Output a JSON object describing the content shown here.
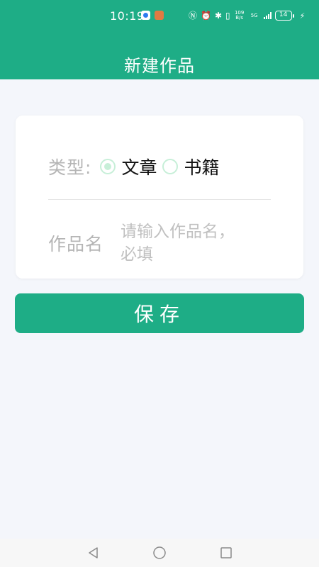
{
  "status_bar": {
    "time": "10:19",
    "net_speed_value": "109",
    "net_speed_unit": "B/s",
    "network": "5G",
    "battery_level": "14"
  },
  "header": {
    "title": "新建作品"
  },
  "form": {
    "type_label": "类型:",
    "type_options": [
      {
        "label": "文章",
        "selected": true
      },
      {
        "label": "书籍",
        "selected": false
      }
    ],
    "name_label": "作品名",
    "name_placeholder": "请输入作品名，必填",
    "name_value": ""
  },
  "actions": {
    "save_label": "保存"
  },
  "colors": {
    "primary": "#1ead86",
    "background": "#f4f6fb",
    "radio_tint": "#c7efd8",
    "label_gray": "#b5b5b5"
  },
  "icons": {
    "nav_back": "triangle-back-icon",
    "nav_home": "circle-home-icon",
    "nav_recent": "square-recent-icon"
  }
}
